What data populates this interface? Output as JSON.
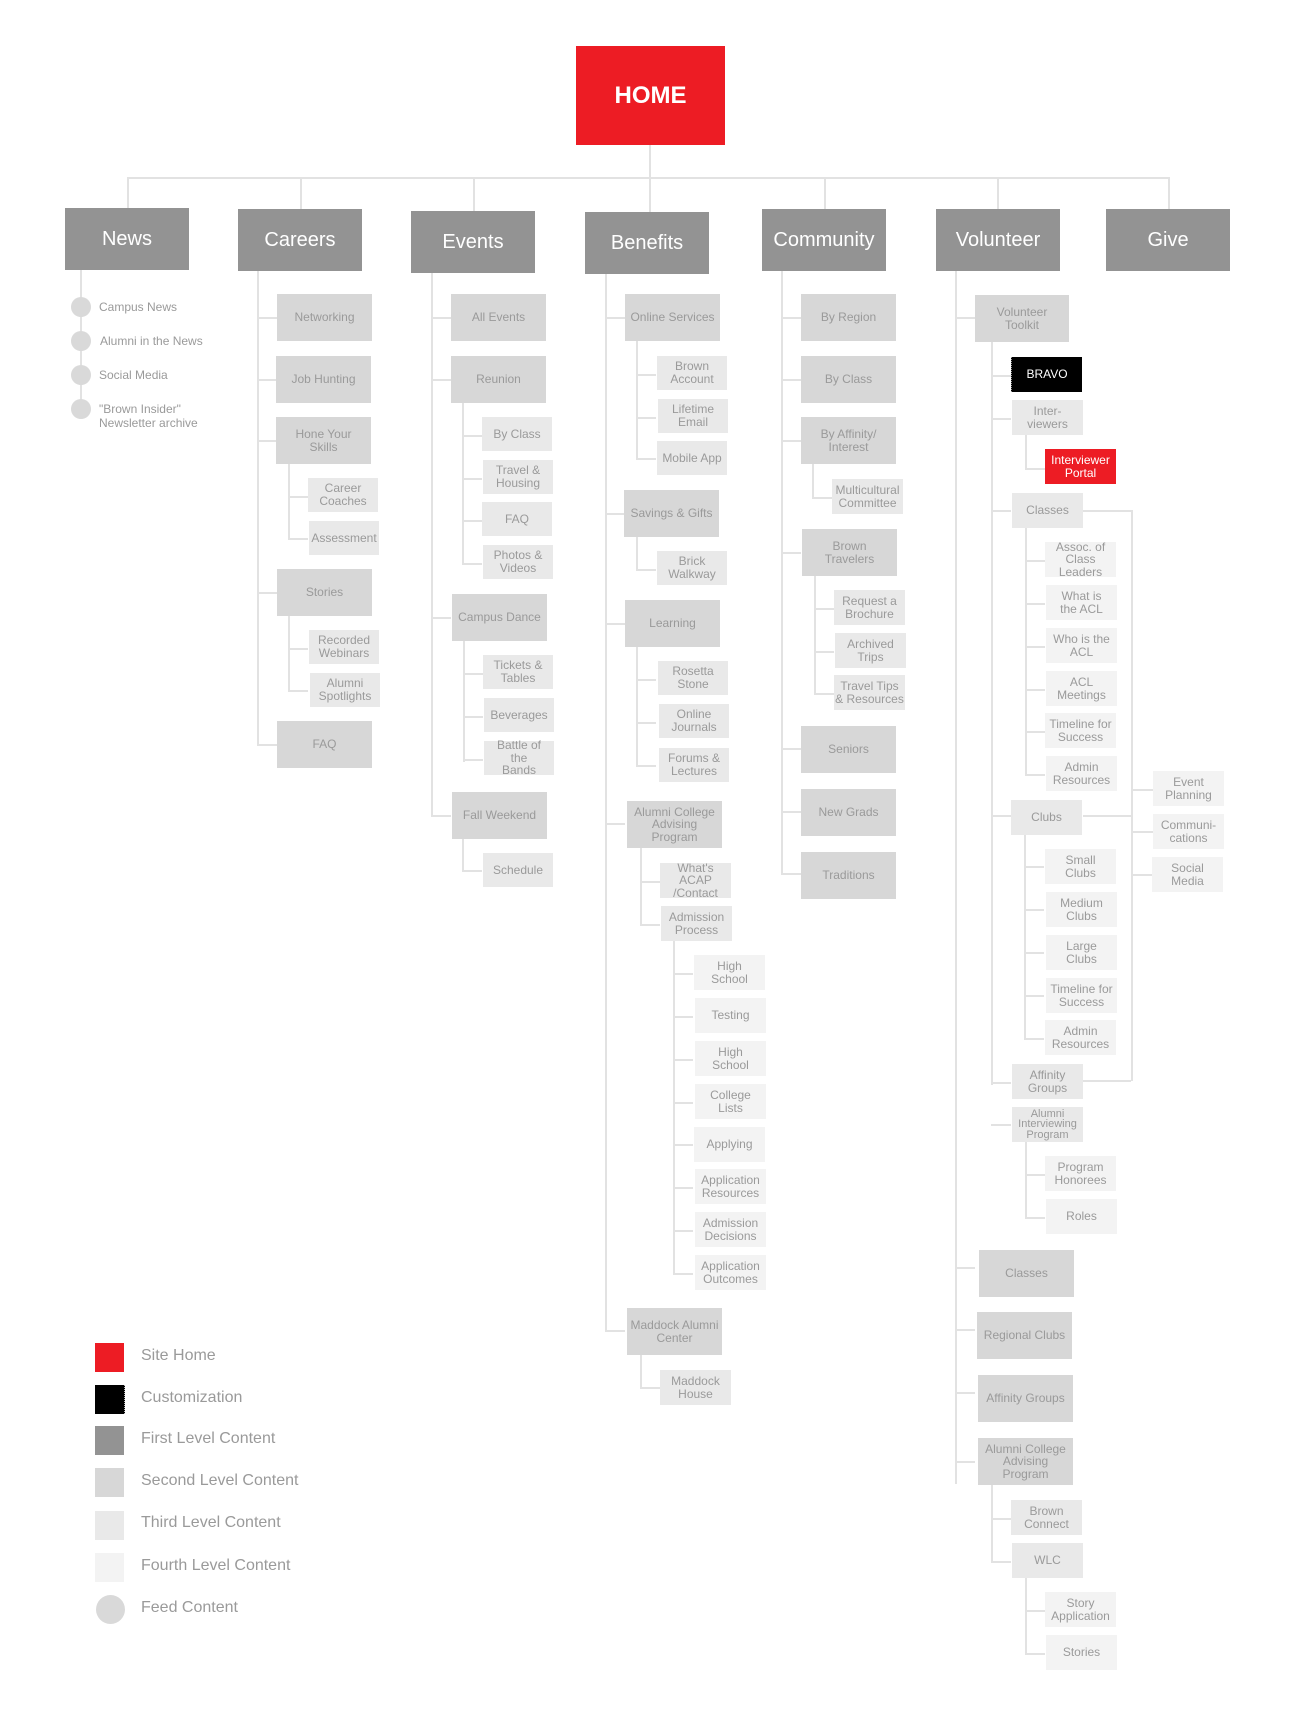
{
  "home": "HOME",
  "first_level": [
    "News",
    "Careers",
    "Events",
    "Benefits",
    "Community",
    "Volunteer",
    "Give"
  ],
  "news": {
    "feed": [
      "Campus News",
      "Alumni in the News",
      "Social Media",
      "\"Brown Insider\" Newsletter archive"
    ]
  },
  "careers": {
    "networking": "Networking",
    "job_hunting": "Job Hunting",
    "hone_skills": "Hone Your Skills",
    "career_coaches": "Career Coaches",
    "assessment": "Assessment",
    "stories": "Stories",
    "recorded_webinars": "Recorded Webinars",
    "alumni_spotlights": "Alumni Spotlights",
    "faq": "FAQ"
  },
  "events": {
    "all_events": "All Events",
    "reunion": "Reunion",
    "by_class": "By Class",
    "travel_housing": "Travel & Housing",
    "faq": "FAQ",
    "photos_videos": "Photos & Videos",
    "campus_dance": "Campus Dance",
    "tickets_tables": "Tickets & Tables",
    "beverages": "Beverages",
    "battle_bands": "Battle of the Bands",
    "fall_weekend": "Fall Weekend",
    "schedule": "Schedule"
  },
  "benefits": {
    "online_services": "Online Services",
    "brown_account": "Brown Account",
    "lifetime_email": "Lifetime Email",
    "mobile_app": "Mobile App",
    "savings_gifts": "Savings & Gifts",
    "brick_walkway": "Brick Walkway",
    "learning": "Learning",
    "rosetta_stone": "Rosetta Stone",
    "online_journals": "Online Journals",
    "forums_lectures": "Forums & Lectures",
    "acap": "Alumni College Advising Program",
    "whats_acap": "What's ACAP /Contact",
    "admission_process": "Admission Process",
    "high_school_1": "High School",
    "testing": "Testing",
    "high_school_2": "High School",
    "college_lists": "College Lists",
    "applying": "Applying",
    "application_resources": "Application Resources",
    "admission_decisions": "Admission Decisions",
    "application_outcomes": "Application Outcomes",
    "maddock_center": "Maddock Alumni Center",
    "maddock_house": "Maddock House"
  },
  "community": {
    "by_region": "By Region",
    "by_class": "By Class",
    "by_affinity": "By Affinity/ Interest",
    "multicultural": "Multicultural Committee",
    "brown_travelers": "Brown Travelers",
    "request_brochure": "Request a Brochure",
    "archived_trips": "Archived Trips",
    "travel_tips": "Travel Tips & Resources",
    "seniors": "Seniors",
    "new_grads": "New Grads",
    "traditions": "Traditions"
  },
  "volunteer": {
    "toolkit": "Volunteer Toolkit",
    "bravo": "BRAVO",
    "interviewers": "Inter- viewers",
    "interviewer_portal": "Interviewer Portal",
    "classes_sub": "Classes",
    "assoc_class_leaders": "Assoc. of Class Leaders",
    "what_is_acl": "What is the ACL",
    "who_is_acl": "Who is the ACL",
    "acl_meetings": "ACL Meetings",
    "timeline_1": "Timeline for Success",
    "admin_resources_1": "Admin Resources",
    "clubs_sub": "Clubs",
    "small_clubs": "Small Clubs",
    "medium_clubs": "Medium Clubs",
    "large_clubs": "Large Clubs",
    "timeline_2": "Timeline for Success",
    "admin_resources_2": "Admin Resources",
    "affinity_groups_sub": "Affinity Groups",
    "alumni_interviewing": "Alumni Interviewing Program",
    "program_honorees": "Program Honorees",
    "roles": "Roles",
    "event_planning": "Event Planning",
    "communications": "Communi- cations",
    "social_media": "Social Media",
    "classes": "Classes",
    "regional_clubs": "Regional Clubs",
    "affinity_groups": "Affinity Groups",
    "acap": "Alumni College Advising Program",
    "brown_connect": "Brown Connect",
    "wlc": "WLC",
    "story_application": "Story Application",
    "stories": "Stories"
  },
  "legend": {
    "items": [
      {
        "label": "Site Home",
        "color": "#ed1c24"
      },
      {
        "label": "Customization",
        "color": "#000000"
      },
      {
        "label": "First Level Content",
        "color": "#939393"
      },
      {
        "label": "Second Level Content",
        "color": "#d7d7d7"
      },
      {
        "label": "Third Level Content",
        "color": "#e9e9e9"
      },
      {
        "label": "Fourth Level Content",
        "color": "#f3f3f3"
      },
      {
        "label": "Feed Content",
        "color": "#d9d9d9"
      }
    ]
  }
}
